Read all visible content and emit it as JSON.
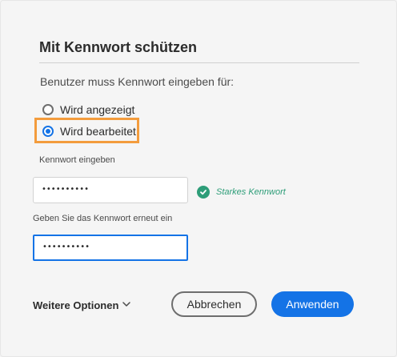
{
  "dialog": {
    "title": "Mit Kennwort schützen",
    "intro": "Benutzer muss Kennwort eingeben für:",
    "options": [
      {
        "label": "Wird angezeigt",
        "selected": false
      },
      {
        "label": "Wird bearbeitet",
        "selected": true
      }
    ],
    "password_label": "Kennwort eingeben",
    "password_value": "••••••••••",
    "strength_text": "Starkes Kennwort",
    "confirm_label": "Geben Sie das Kennwort erneut ein",
    "confirm_value": "••••••••••",
    "more_options": "Weitere Optionen",
    "cancel_label": "Abbrechen",
    "apply_label": "Anwenden"
  },
  "colors": {
    "accent": "#1473e6",
    "success": "#2d9d78",
    "highlight": "#f39c3d"
  },
  "icons": [
    "radio-off-icon",
    "radio-on-icon",
    "check-circle-icon",
    "chevron-down-icon"
  ]
}
